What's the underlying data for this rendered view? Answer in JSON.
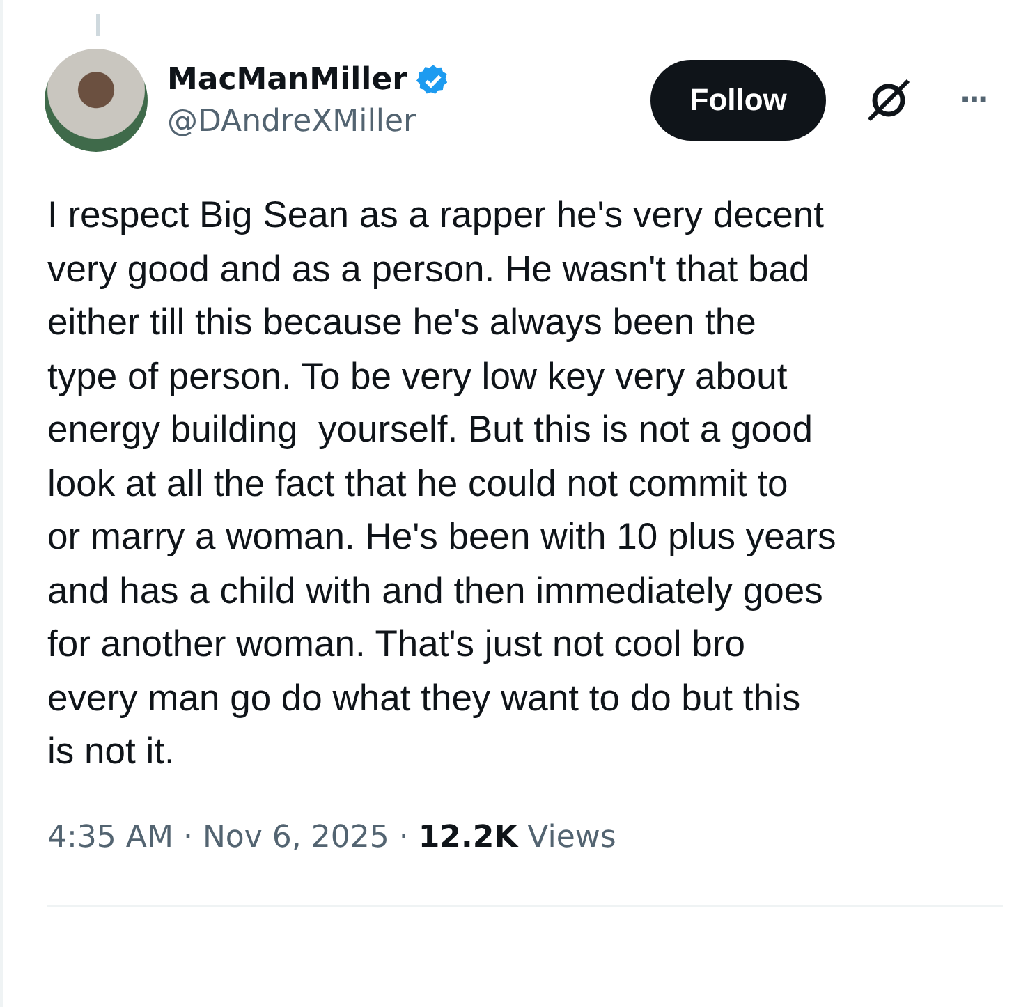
{
  "author": {
    "name": "MacManMiller",
    "verified": true,
    "handle": "@DAndreXMiller"
  },
  "follow_button": {
    "label": "Follow"
  },
  "more_button": {
    "label": "···"
  },
  "body_lines": [
    "I respect Big Sean as a rapper he's very decent",
    "very good and as a person. He wasn't that bad",
    "either till this because he's always been the",
    "type of person. To be very low key very about",
    "energy building  yourself. But this is not a good",
    "look at all the fact that he could not commit to",
    "or marry a woman. He's been with 10 plus years",
    "and has a child with and then immediately goes",
    "for another woman. That's just not cool bro",
    "every man go do what they want to do but this",
    "is not it."
  ],
  "meta": [
    {
      "kind": "time",
      "text": "4:35 AM"
    },
    {
      "kind": "dot",
      "text": "·"
    },
    {
      "kind": "date",
      "text": "Nov 6, 2025"
    },
    {
      "kind": "dot",
      "text": "·"
    },
    {
      "kind": "count",
      "text": "12.2K"
    },
    {
      "kind": "label",
      "text": "Views"
    }
  ]
}
